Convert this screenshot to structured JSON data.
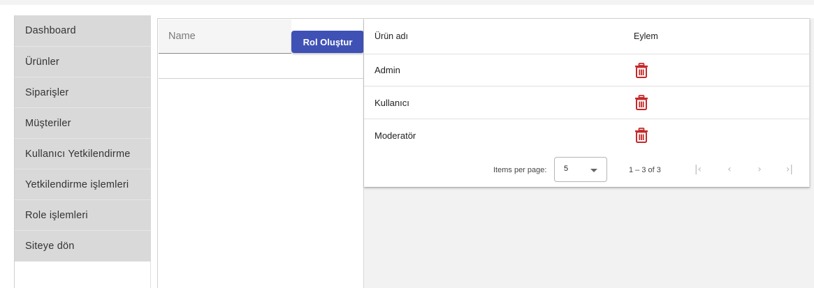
{
  "sidebar": {
    "items": [
      {
        "label": "Dashboard"
      },
      {
        "label": "Ürünler"
      },
      {
        "label": "Siparişler"
      },
      {
        "label": "Müşteriler"
      },
      {
        "label": "Kullanıcı Yetkilendirme"
      },
      {
        "label": "Yetkilendirme işlemleri"
      },
      {
        "label": "Role işlemleri"
      },
      {
        "label": "Siteye dön"
      }
    ]
  },
  "form": {
    "name_placeholder": "Name",
    "name_value": "",
    "create_button": "Rol Oluştur"
  },
  "table": {
    "headers": {
      "name": "Ürün adı",
      "action": "Eylem"
    },
    "rows": [
      {
        "name": "Admin",
        "action_icon": "trash-icon"
      },
      {
        "name": "Kullanıcı",
        "action_icon": "trash-icon"
      },
      {
        "name": "Moderatör",
        "action_icon": "trash-icon"
      }
    ],
    "delete_icon_color": "#c62828"
  },
  "paginator": {
    "items_per_page_label": "Items per page:",
    "items_per_page_value": "5",
    "range_label": "1 – 3 of 3",
    "first_icon": "first-page-icon",
    "prev_icon": "chevron-left-icon",
    "next_icon": "chevron-right-icon",
    "last_icon": "last-page-icon"
  },
  "colors": {
    "accent": "#3f51b5",
    "sidebar_bg": "#d9d9d9"
  }
}
